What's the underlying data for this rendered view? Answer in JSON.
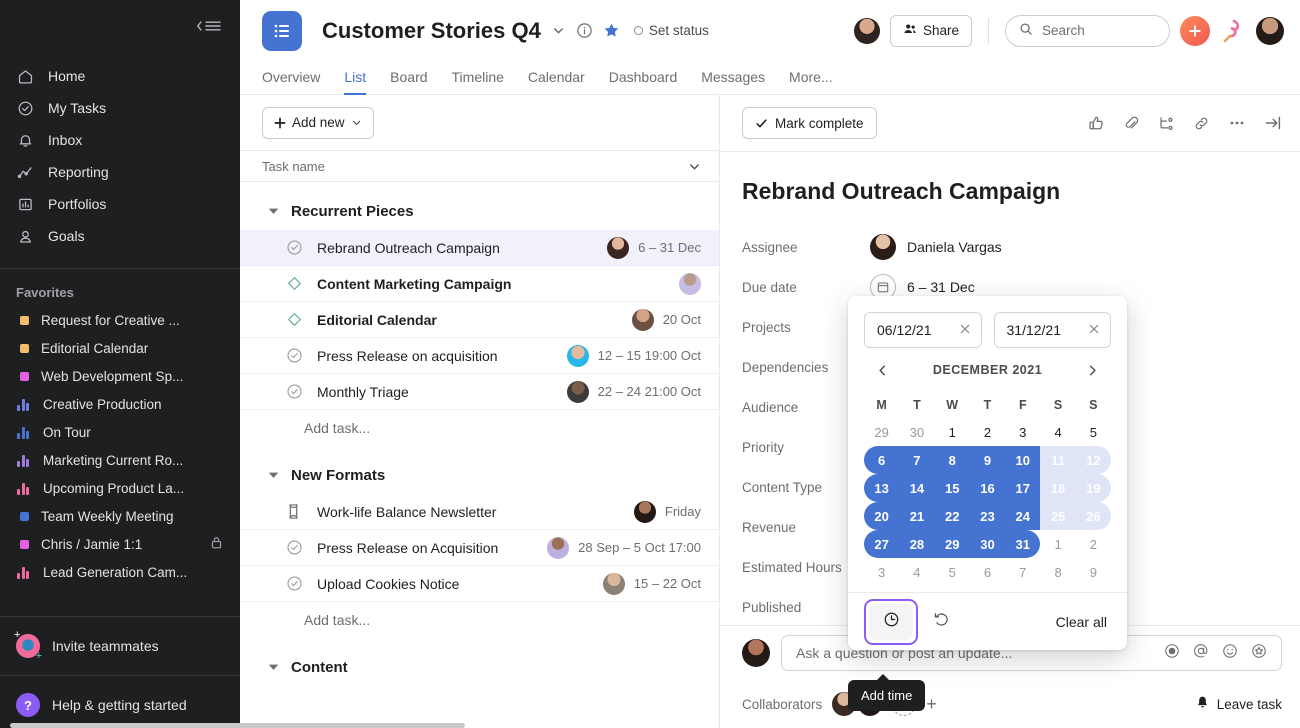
{
  "sidebar": {
    "collapse_icon": "hamburger-collapse-icon",
    "nav": [
      {
        "label": "Home",
        "icon": "home-icon"
      },
      {
        "label": "My Tasks",
        "icon": "check-circle-icon"
      },
      {
        "label": "Inbox",
        "icon": "bell-icon"
      },
      {
        "label": "Reporting",
        "icon": "line-chart-icon"
      },
      {
        "label": "Portfolios",
        "icon": "portfolio-icon"
      },
      {
        "label": "Goals",
        "icon": "goal-person-icon"
      }
    ],
    "favorites_label": "Favorites",
    "favorites": [
      {
        "label": "Request for Creative ...",
        "marker": "square",
        "color": "#f1bd6c"
      },
      {
        "label": "Editorial Calendar",
        "marker": "square",
        "color": "#f1bd6c"
      },
      {
        "label": "Web Development Sp...",
        "marker": "square",
        "color": "#e362e3"
      },
      {
        "label": "Creative Production",
        "marker": "bars",
        "color": "#6e7ce0"
      },
      {
        "label": "On Tour",
        "marker": "bars",
        "color": "#4573d2"
      },
      {
        "label": "Marketing Current Ro...",
        "marker": "bars",
        "color": "#9e7ddb"
      },
      {
        "label": "Upcoming Product La...",
        "marker": "bars",
        "color": "#f06a9b"
      },
      {
        "label": "Team Weekly Meeting",
        "marker": "square",
        "color": "#4573d2"
      },
      {
        "label": "Chris / Jamie 1:1",
        "marker": "square",
        "color": "#e362e3",
        "locked": true
      },
      {
        "label": "Lead Generation Cam...",
        "marker": "bars",
        "color": "#f06a9b"
      }
    ],
    "invite_label": "Invite teammates",
    "help_label": "Help & getting started"
  },
  "topbar": {
    "project_icon": "list-project-icon",
    "project_title": "Customer Stories Q4",
    "chevron_icon": "chevron-down-icon",
    "info_icon": "info-circle-icon",
    "star_icon": "star-filled-icon",
    "set_status_label": "Set status",
    "share_label": "Share",
    "share_icon": "people-icon",
    "search_placeholder": "Search",
    "search_icon": "search-icon",
    "plus_label": "+",
    "accent_color": "#4573d2"
  },
  "tabs": [
    {
      "label": "Overview",
      "active": false
    },
    {
      "label": "List",
      "active": true
    },
    {
      "label": "Board",
      "active": false
    },
    {
      "label": "Timeline",
      "active": false
    },
    {
      "label": "Calendar",
      "active": false
    },
    {
      "label": "Dashboard",
      "active": false
    },
    {
      "label": "Messages",
      "active": false
    },
    {
      "label": "More...",
      "active": false
    }
  ],
  "list": {
    "add_new_label": "Add new",
    "column_header": "Task name",
    "column_chevron_icon": "chevron-down-icon",
    "add_task_label": "Add task...",
    "groups": [
      {
        "title": "Recurrent Pieces",
        "tasks": [
          {
            "name": "Rebrand Outreach Campaign",
            "icon": "check-circle-icon",
            "date": "6 – 31 Dec",
            "bold": false,
            "selected": true,
            "avatar": "#8d6b5c"
          },
          {
            "name": "Content Marketing Campaign",
            "icon": "milestone-diamond-icon",
            "date": "",
            "bold": true,
            "selected": false,
            "avatar": "#c4b5e8"
          },
          {
            "name": "Editorial Calendar",
            "icon": "milestone-diamond-icon",
            "date": "20 Oct",
            "bold": true,
            "selected": false,
            "avatar": "#a9714b"
          },
          {
            "name": "Press Release on acquisition",
            "icon": "check-circle-icon",
            "date": "12 – 15 19:00 Oct",
            "bold": false,
            "selected": false,
            "avatar": "#29b6e8"
          },
          {
            "name": "Monthly Triage",
            "icon": "check-circle-icon",
            "date": "22 – 24 21:00 Oct",
            "bold": false,
            "selected": false,
            "avatar": "#5b5b5b"
          }
        ]
      },
      {
        "title": "New Formats",
        "tasks": [
          {
            "name": "Work-life Balance Newsletter",
            "icon": "hourglass-icon",
            "date": "Friday",
            "bold": false,
            "selected": false,
            "avatar": "#3f2a22"
          },
          {
            "name": "Press Release on Acquisition",
            "icon": "check-circle-icon",
            "date": "28 Sep – 5 Oct 17:00",
            "bold": false,
            "selected": false,
            "avatar": "#b6a8df"
          },
          {
            "name": "Upload Cookies Notice",
            "icon": "check-circle-icon",
            "date": "15 – 22 Oct",
            "bold": false,
            "selected": false,
            "avatar": "#9a8c7a"
          }
        ]
      },
      {
        "title": "Content",
        "tasks": []
      }
    ]
  },
  "detail": {
    "mark_complete_label": "Mark complete",
    "icons": [
      "thumbs-up-icon",
      "paperclip-icon",
      "subtask-icon",
      "link-icon",
      "more-horizontal-icon",
      "collapse-right-icon"
    ],
    "title": "Rebrand Outreach Campaign",
    "fields": [
      {
        "label": "Assignee",
        "value": "Daniela Vargas",
        "kind": "avatar"
      },
      {
        "label": "Due date",
        "value": "6 – 31 Dec",
        "kind": "calendar"
      },
      {
        "label": "Projects",
        "value": "",
        "kind": "plain"
      },
      {
        "label": "Dependencies",
        "value": "",
        "kind": "plain"
      },
      {
        "label": "Audience",
        "value": "",
        "kind": "plain"
      },
      {
        "label": "Priority",
        "value": "",
        "kind": "plain"
      },
      {
        "label": "Content Type",
        "value": "",
        "kind": "plain"
      },
      {
        "label": "Revenue",
        "value": "",
        "kind": "plain"
      },
      {
        "label": "Estimated Hours",
        "value": "",
        "kind": "plain"
      },
      {
        "label": "Published",
        "value": "",
        "kind": "plain"
      }
    ],
    "comment_placeholder": "Ask a question or post an update...",
    "comment_icons": [
      "record-icon",
      "mention-icon",
      "emoji-icon",
      "sticker-icon"
    ],
    "collaborators_label": "Collaborators",
    "add_collaborator_label": "+",
    "leave_task_label": "Leave task",
    "leave_task_icon": "bell-icon"
  },
  "datepicker": {
    "start_value": "06/12/21",
    "end_value": "31/12/21",
    "clear_icon": "close-x-icon",
    "prev_icon": "chevron-left-icon",
    "next_icon": "chevron-right-icon",
    "month_label": "DECEMBER 2021",
    "dow": [
      "M",
      "T",
      "W",
      "T",
      "F",
      "S",
      "S"
    ],
    "weeks": [
      [
        {
          "d": "29",
          "state": "muted"
        },
        {
          "d": "30",
          "state": "muted"
        },
        {
          "d": "1",
          "state": "normal"
        },
        {
          "d": "2",
          "state": "normal"
        },
        {
          "d": "3",
          "state": "normal"
        },
        {
          "d": "4",
          "state": "normal"
        },
        {
          "d": "5",
          "state": "normal"
        }
      ],
      [
        {
          "d": "6",
          "state": "sel start"
        },
        {
          "d": "7",
          "state": "sel"
        },
        {
          "d": "8",
          "state": "sel"
        },
        {
          "d": "9",
          "state": "sel"
        },
        {
          "d": "10",
          "state": "sel"
        },
        {
          "d": "11",
          "state": "weekend"
        },
        {
          "d": "12",
          "state": "weekend endcap"
        }
      ],
      [
        {
          "d": "13",
          "state": "sel start"
        },
        {
          "d": "14",
          "state": "sel"
        },
        {
          "d": "15",
          "state": "sel"
        },
        {
          "d": "16",
          "state": "sel"
        },
        {
          "d": "17",
          "state": "sel"
        },
        {
          "d": "18",
          "state": "weekend"
        },
        {
          "d": "19",
          "state": "weekend endcap"
        }
      ],
      [
        {
          "d": "20",
          "state": "sel start"
        },
        {
          "d": "21",
          "state": "sel"
        },
        {
          "d": "22",
          "state": "sel"
        },
        {
          "d": "23",
          "state": "sel"
        },
        {
          "d": "24",
          "state": "sel"
        },
        {
          "d": "25",
          "state": "weekend"
        },
        {
          "d": "26",
          "state": "weekend endcap"
        }
      ],
      [
        {
          "d": "27",
          "state": "sel start"
        },
        {
          "d": "28",
          "state": "sel"
        },
        {
          "d": "29",
          "state": "sel"
        },
        {
          "d": "30",
          "state": "sel"
        },
        {
          "d": "31",
          "state": "sel endcap"
        },
        {
          "d": "1",
          "state": "muted"
        },
        {
          "d": "2",
          "state": "muted"
        }
      ],
      [
        {
          "d": "3",
          "state": "muted"
        },
        {
          "d": "4",
          "state": "muted"
        },
        {
          "d": "5",
          "state": "muted"
        },
        {
          "d": "6",
          "state": "muted"
        },
        {
          "d": "7",
          "state": "muted"
        },
        {
          "d": "8",
          "state": "muted"
        },
        {
          "d": "9",
          "state": "muted"
        }
      ]
    ],
    "time_icon": "clock-icon",
    "repeat_icon": "repeat-icon",
    "clear_all_label": "Clear all",
    "selected_color": "#4573d2",
    "weekend_color": "#dfe4f7",
    "focus_ring_color": "#8b5cf6"
  },
  "tooltip": {
    "label": "Add time"
  }
}
